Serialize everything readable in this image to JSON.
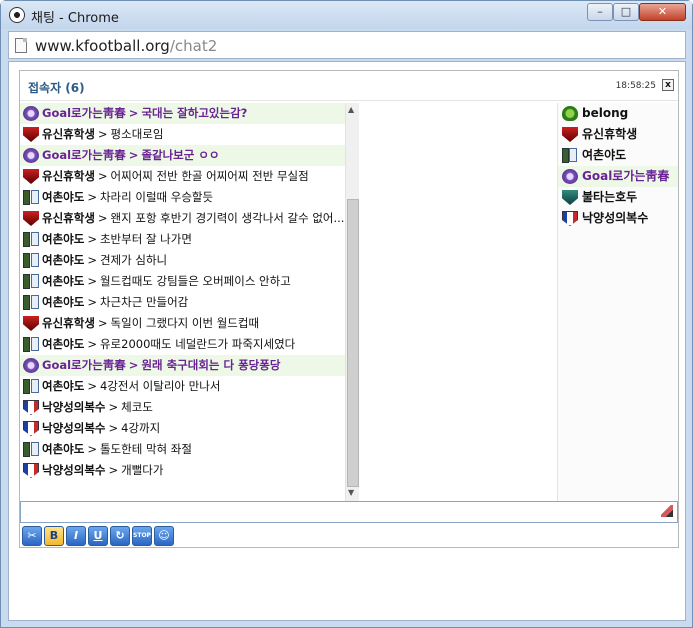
{
  "window": {
    "title": "채팅 - Chrome"
  },
  "address": {
    "host": "www.kfootball.org",
    "path": "/chat2"
  },
  "chat": {
    "users_title": "접속자 (6)",
    "clock": "18:58:25",
    "close_label": "x",
    "messages": [
      {
        "nick": "Goal로가는靑春",
        "text": "국대는 잘하고있는감?",
        "icon": "crest-purple",
        "highlight": true
      },
      {
        "nick": "유신휴학생",
        "text": "평소대로임",
        "icon": "shield-red",
        "highlight": false
      },
      {
        "nick": "Goal로가는靑春",
        "text": "졸같나보군 ㅇㅇ",
        "icon": "crest-purple",
        "highlight": true
      },
      {
        "nick": "유신휴학생",
        "text": "어찌어찌 전반 한골 어찌어찌 전반 무실점",
        "icon": "shield-red",
        "highlight": false
      },
      {
        "nick": "여촌야도",
        "text": "차라리 이럴때 우승할듯",
        "icon": "phone",
        "highlight": false
      },
      {
        "nick": "유신휴학생",
        "text": "왠지 포항 후반기 경기력이 생각나서 갈수 없어....",
        "icon": "shield-red",
        "highlight": false
      },
      {
        "nick": "여촌야도",
        "text": "초반부터 잘 나가면",
        "icon": "phone",
        "highlight": false
      },
      {
        "nick": "여촌야도",
        "text": "견제가 심하니",
        "icon": "phone",
        "highlight": false
      },
      {
        "nick": "여촌야도",
        "text": "월드컵때도 강팀들은 오버페이스 안하고",
        "icon": "phone",
        "highlight": false
      },
      {
        "nick": "여촌야도",
        "text": "차근차근 만들어감",
        "icon": "phone",
        "highlight": false
      },
      {
        "nick": "유신휴학생",
        "text": "독일이 그랬다지 이번 월드컵때",
        "icon": "shield-red",
        "highlight": false
      },
      {
        "nick": "여촌야도",
        "text": "유로2000때도 네덜란드가 파죽지세였다",
        "icon": "phone",
        "highlight": false
      },
      {
        "nick": "Goal로가는靑春",
        "text": "원래 축구대회는 다 퐁당퐁당",
        "icon": "crest-purple",
        "highlight": true
      },
      {
        "nick": "여촌야도",
        "text": "4강전서 이탈리아 만나서",
        "icon": "phone",
        "highlight": false
      },
      {
        "nick": "낙양성의복수",
        "text": "체코도",
        "icon": "shield-white",
        "highlight": false
      },
      {
        "nick": "낙양성의복수",
        "text": "4강까지",
        "icon": "shield-white",
        "highlight": false
      },
      {
        "nick": "여촌야도",
        "text": "톨도한테 막혀 좌절",
        "icon": "phone",
        "highlight": false
      },
      {
        "nick": "낙양성의복수",
        "text": "개뻘다가",
        "icon": "shield-white",
        "highlight": false
      }
    ],
    "users": [
      {
        "name": "belong",
        "icon": "green",
        "highlight": false
      },
      {
        "name": "유신휴학생",
        "icon": "shield-red",
        "highlight": false
      },
      {
        "name": "여촌야도",
        "icon": "phone",
        "highlight": false
      },
      {
        "name": "Goal로가는靑春",
        "icon": "crest-purple",
        "highlight": true
      },
      {
        "name": "불타는호두",
        "icon": "teal",
        "highlight": false
      },
      {
        "name": "낙양성의복수",
        "icon": "shield-white",
        "highlight": false
      }
    ],
    "input": {
      "value": "",
      "placeholder": ""
    },
    "toolbar": {
      "buttons": [
        {
          "name": "emoticon-button",
          "label": "✂"
        },
        {
          "name": "bold-button",
          "label": "B"
        },
        {
          "name": "italic-button",
          "label": "I"
        },
        {
          "name": "underline-button",
          "label": "U"
        },
        {
          "name": "refresh-button",
          "label": "↻"
        },
        {
          "name": "stop-button",
          "label": "STOP"
        },
        {
          "name": "user-button",
          "label": "☺"
        }
      ]
    }
  }
}
